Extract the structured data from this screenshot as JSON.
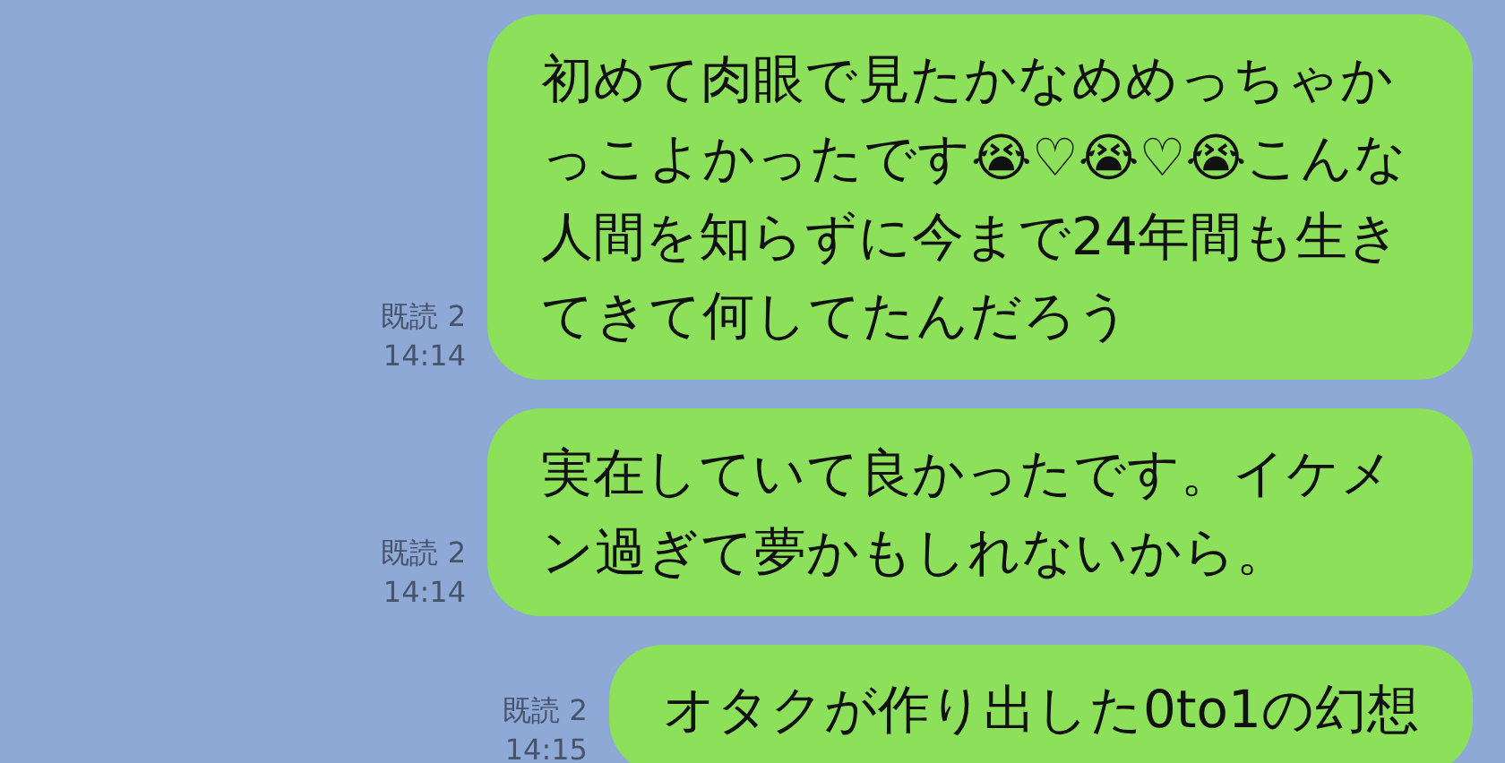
{
  "messages": [
    {
      "text": "初めて肉眼で見たかなめめっちゃかっこよかったです😭♡😭♡😭こんな人間を知らずに今まで24年間も生きてきて何してたんだろう",
      "read": "既読 2",
      "time": "14:14"
    },
    {
      "text": "実在していて良かったです。イケメン過ぎて夢かもしれないから。",
      "read": "既読 2",
      "time": "14:14"
    },
    {
      "text": "オタクが作り出した0to1の幻想",
      "read": "既読 2",
      "time": "14:15"
    }
  ]
}
